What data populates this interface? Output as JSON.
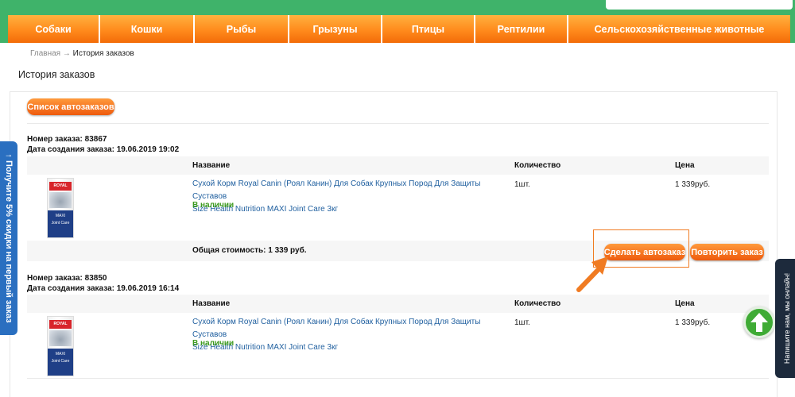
{
  "nav": {
    "items": [
      "Собаки",
      "Кошки",
      "Рыбы",
      "Грызуны",
      "Птицы",
      "Рептилии",
      "Сельскохозяйственные животные"
    ]
  },
  "breadcrumb": {
    "home": "Главная",
    "separator": "→",
    "current": "История заказов"
  },
  "page_title": "История заказов",
  "autoorders_button": "Список автозаказов",
  "table_headers": {
    "name": "Название",
    "quantity": "Количество",
    "price": "Цена"
  },
  "orders": [
    {
      "number_label": "Номер заказа: 83867",
      "date_label": "Дата создания заказа: 19.06.2019 19:02",
      "product_line1": "Сухой Корм Royal Canin (Роял Канин) Для Собак Крупных Пород Для Защиты Суставов",
      "product_line2": "Size Health Nutrition MAXI Joint Care 3кг",
      "availability": "В наличии",
      "quantity": "1шт.",
      "price": "1 339руб.",
      "total": "Общая стоимость: 1 339 руб.",
      "make_autoorder": "Сделать автозаказ",
      "repeat_order": "Повторить заказ"
    },
    {
      "number_label": "Номер заказа: 83850",
      "date_label": "Дата создания заказа: 19.06.2019 16:14",
      "product_line1": "Сухой Корм Royal Canin (Роял Канин) Для Собак Крупных Пород Для Защиты Суставов",
      "product_line2": "Size Health Nutrition MAXI Joint Care 3кг",
      "availability": "В наличии",
      "quantity": "1шт.",
      "price": "1 339руб."
    }
  ],
  "product_pack": {
    "brand": "ROYAL CANIN",
    "line": "MAXI",
    "variant": "Joint Care"
  },
  "side_tabs": {
    "left": "↑ Получите 5% скидки на первый заказ",
    "right": "Напишите нам, мы онлайн!"
  },
  "icons": {
    "scroll_top": "arrow-up-icon",
    "pointer": "orange-arrow-icon"
  },
  "colors": {
    "nav_green": "#3fb36a",
    "nav_orange": "#ff8a1c",
    "button_orange": "#ee5a0d",
    "link_blue": "#1f5f9f",
    "stock_green": "#3c9a1e",
    "side_tab_blue": "#2a6fc0",
    "chat_tab_dark": "#1d2a3c"
  }
}
